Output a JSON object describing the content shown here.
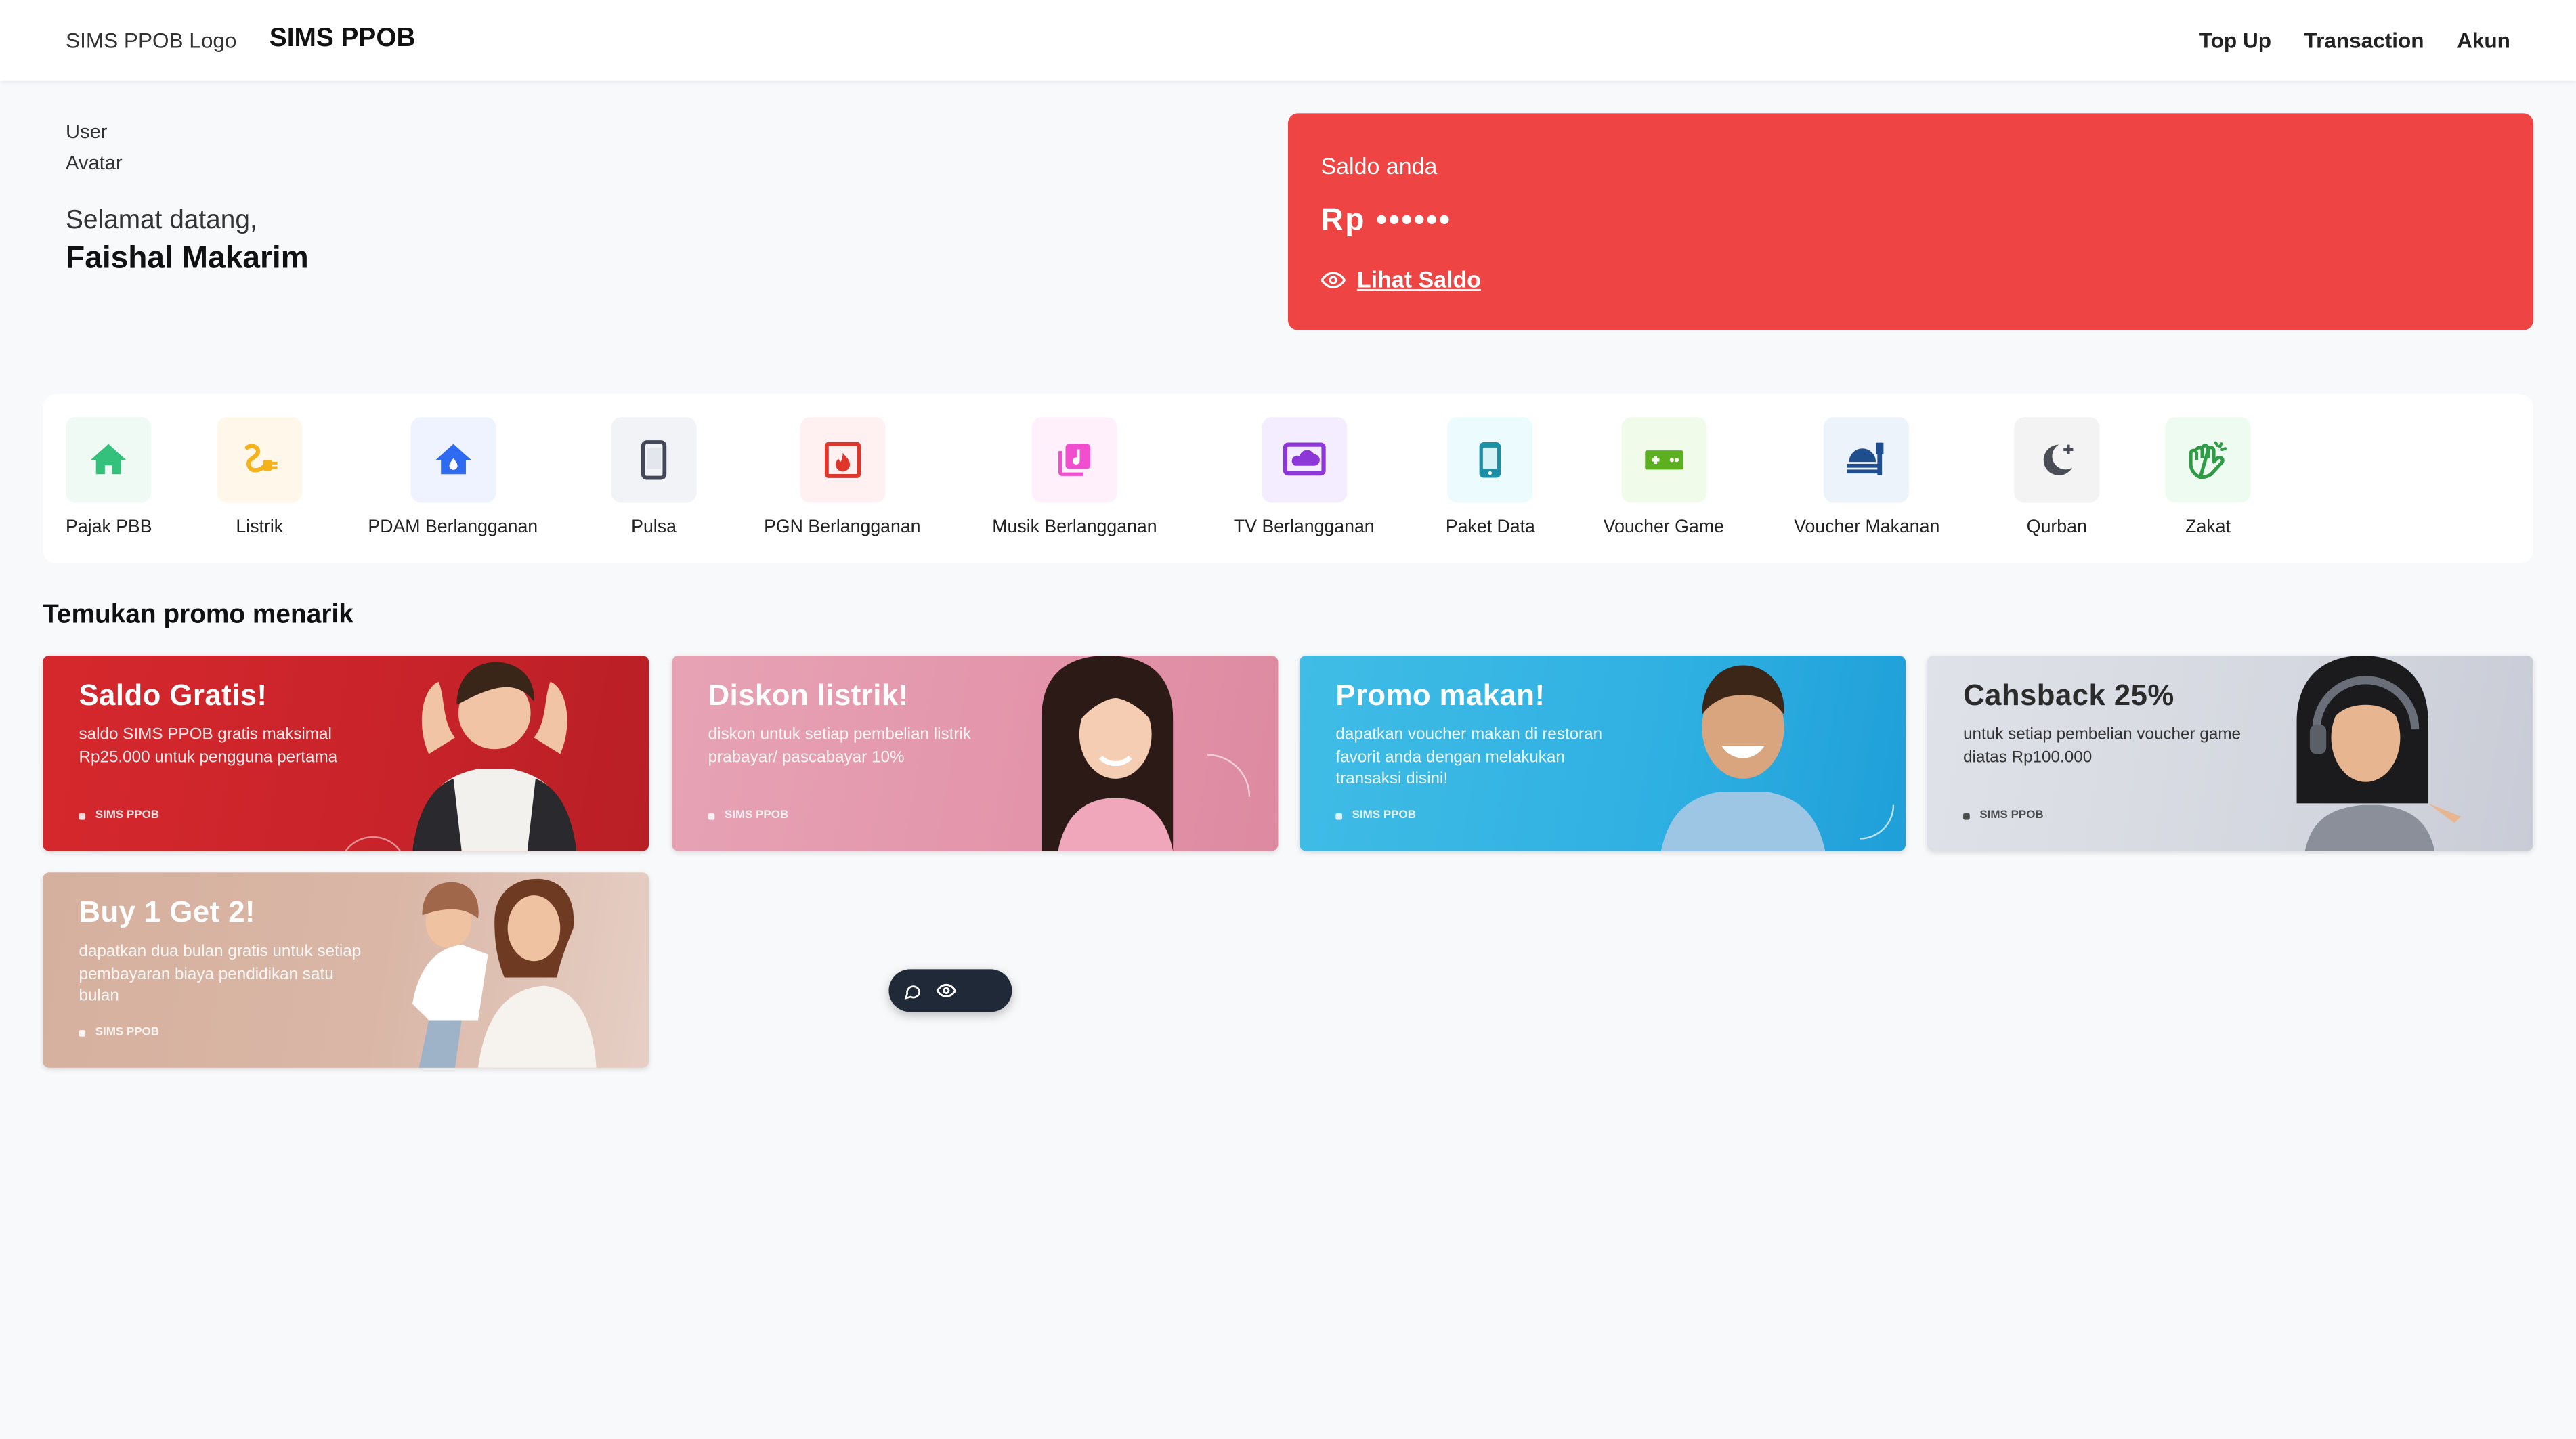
{
  "header": {
    "logo_alt": "SIMS PPOB Logo",
    "brand": "SIMS PPOB",
    "nav": [
      "Top Up",
      "Transaction",
      "Akun"
    ]
  },
  "profile": {
    "avatar_alt": "User Avatar",
    "greeting": "Selamat datang,",
    "name": "Faishal Makarim"
  },
  "balance": {
    "label": "Saldo anda",
    "amount": "Rp ••••••",
    "toggle_label": "Lihat Saldo",
    "card_color": "#ef4444"
  },
  "services": [
    {
      "label": "Pajak PBB",
      "icon": "house-icon",
      "bg": "#eefaf3",
      "color": "#34c17b"
    },
    {
      "label": "Listrik",
      "icon": "plug-icon",
      "bg": "#fff8ea",
      "color": "#f5b21b"
    },
    {
      "label": "PDAM Berlangganan",
      "icon": "water-home-icon",
      "bg": "#eef3ff",
      "color": "#2f6bf2"
    },
    {
      "label": "Pulsa",
      "icon": "phone-icon",
      "bg": "#f2f3f7",
      "color": "#44475a"
    },
    {
      "label": "PGN Berlangganan",
      "icon": "gas-flame-icon",
      "bg": "#fff1f1",
      "color": "#e0362c"
    },
    {
      "label": "Musik Berlangganan",
      "icon": "music-icon",
      "bg": "#fff0fb",
      "color": "#f24fd0"
    },
    {
      "label": "TV Berlangganan",
      "icon": "tv-icon",
      "bg": "#f4ecff",
      "color": "#8e37d9"
    },
    {
      "label": "Paket Data",
      "icon": "mobile-data-icon",
      "bg": "#ecfbfd",
      "color": "#1a8fa6"
    },
    {
      "label": "Voucher Game",
      "icon": "gamepad-icon",
      "bg": "#f1fbe9",
      "color": "#5caf1f"
    },
    {
      "label": "Voucher Makanan",
      "icon": "food-icon",
      "bg": "#edf3fb",
      "color": "#1f4e8f"
    },
    {
      "label": "Qurban",
      "icon": "moon-icon",
      "bg": "#f3f3f3",
      "color": "#4a4d55"
    },
    {
      "label": "Zakat",
      "icon": "hands-icon",
      "bg": "#eefbf1",
      "color": "#2e9d46"
    }
  ],
  "promo_section": {
    "title": "Temukan promo menarik"
  },
  "promos": [
    {
      "title": "Saldo Gratis!",
      "desc": "saldo SIMS PPOB gratis maksimal Rp25.000 untuk pengguna pertama",
      "tag": "SIMS PPOB",
      "bg": "#d5282d"
    },
    {
      "title": "Diskon listrik!",
      "desc": "diskon untuk setiap pembelian listrik prabayar/ pascabayar 10%",
      "tag": "SIMS PPOB",
      "bg": "#e7a3b5"
    },
    {
      "title": "Promo makan!",
      "desc": "dapatkan voucher makan di restoran favorit anda dengan melakukan transaksi disini!",
      "tag": "SIMS PPOB",
      "bg": "#40bde6"
    },
    {
      "title": "Cahsback 25%",
      "desc": "untuk setiap pembelian voucher game diatas Rp100.000",
      "tag": "SIMS PPOB",
      "bg": "#d4d7df"
    },
    {
      "title": "Buy 1 Get 2!",
      "desc": "dapatkan dua bulan gratis untuk setiap pembayaran biaya pendidikan satu bulan",
      "tag": "SIMS PPOB",
      "bg": "#d6b09e"
    }
  ]
}
